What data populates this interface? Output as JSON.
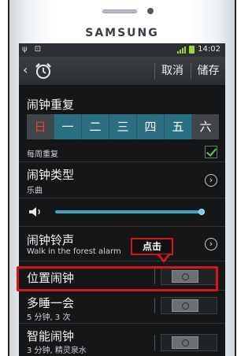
{
  "device": {
    "brand": "SAMSUNG"
  },
  "statusbar": {
    "time": "14:02",
    "left_icons": "ψ ⊡"
  },
  "actionbar": {
    "back": "‹",
    "cancel_label": "取消",
    "save_label": "储存"
  },
  "repeat": {
    "title": "闹钟重复",
    "days": [
      "日",
      "一",
      "二",
      "三",
      "四",
      "五",
      "六"
    ],
    "weekly_label": "每周重复",
    "weekly_checked": true
  },
  "alarm_type": {
    "title": "闹钟类型",
    "value": "乐曲"
  },
  "volume": {
    "level": 0.98
  },
  "ringtone": {
    "title": "闹钟铃声",
    "value": "Walk in the forest alarm"
  },
  "location_alarm": {
    "title": "位置闹钟",
    "enabled": false
  },
  "snooze": {
    "title": "多睡一会",
    "value": "5 分钟, 3 次",
    "enabled": false
  },
  "smart_alarm": {
    "title": "智能闹钟",
    "value": "3 分钟, 精灵泉水",
    "enabled": false
  },
  "annotation": {
    "callout_label": "点击",
    "highlight_color": "#d6161f"
  }
}
